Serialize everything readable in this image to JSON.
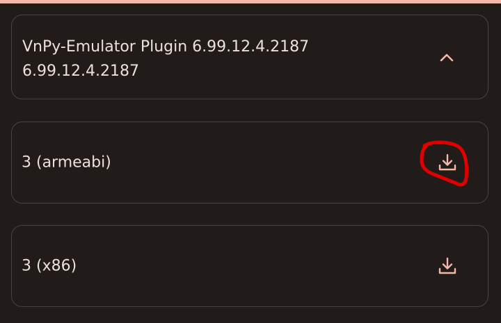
{
  "plugin": {
    "title_line1": "VnPy-Emulator Plugin 6.99.12.4.2187",
    "title_line2": "6.99.12.4.2187",
    "collapse_icon": "chevron-up-icon"
  },
  "variants": [
    {
      "label": "3 (armeabi)",
      "icon": "download-icon",
      "highlighted": true
    },
    {
      "label": "3 (x86)",
      "icon": "download-icon",
      "highlighted": false
    }
  ],
  "colors": {
    "background": "#211b1a",
    "card_border": "#4a4341",
    "text": "#ece0dc",
    "accent": "#f3b8a8",
    "annotation": "#e00000"
  }
}
